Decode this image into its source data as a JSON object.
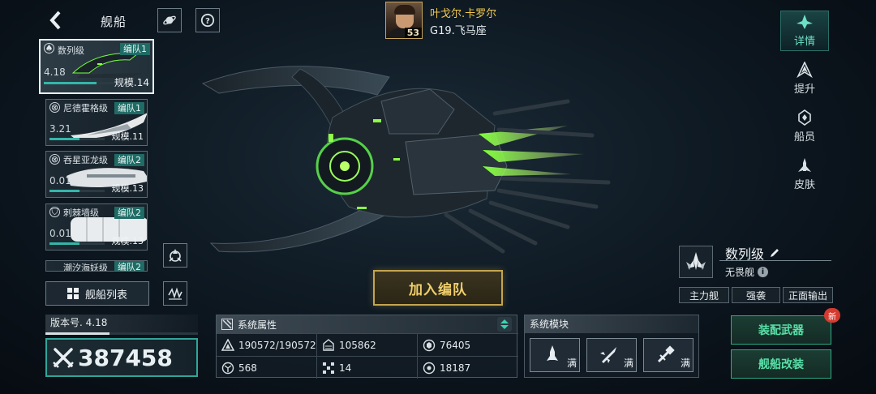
{
  "header": {
    "title": "舰船",
    "back_icon": "chevron-left-icon",
    "planet_icon": "planet-icon",
    "help_icon": "question-icon"
  },
  "captain": {
    "name": "叶戈尔.卡罗尔",
    "level": "53",
    "location": "G19.飞马座"
  },
  "ship_list": [
    {
      "name": "数列级",
      "fleet": "编队1",
      "power": "4.18",
      "scale": "规模.14",
      "hp": 0.72,
      "selected": true
    },
    {
      "name": "尼德霍格级",
      "fleet": "编队1",
      "power": "3.21",
      "scale": "规模.11",
      "hp": 0.55,
      "selected": false
    },
    {
      "name": "吞星亚龙级",
      "fleet": "编队2",
      "power": "0.01",
      "scale": "规模.13",
      "hp": 0.55,
      "selected": false
    },
    {
      "name": "刺棘墙级",
      "fleet": "编队2",
      "power": "0.01",
      "scale": "规模.13",
      "hp": 0.55,
      "selected": false
    },
    {
      "name": "潮汐海妖级",
      "fleet": "编队2"
    }
  ],
  "fleet_list_button": "舰船列表",
  "version": "版本号. 4.18",
  "version_progress": 0.42,
  "combat_power": "387458",
  "attributes": {
    "title": "系统属性",
    "items": [
      {
        "icon": "hull-icon",
        "value": "190572/190572"
      },
      {
        "icon": "armor-icon",
        "value": "105862"
      },
      {
        "icon": "shield-icon",
        "value": "76405"
      },
      {
        "icon": "speed-icon",
        "value": "568"
      },
      {
        "icon": "grid-icon",
        "value": "14"
      },
      {
        "icon": "target-icon",
        "value": "18187"
      }
    ]
  },
  "modules": {
    "title": "系统模块",
    "slots": [
      {
        "icon": "rocket-module-icon",
        "label": "满"
      },
      {
        "icon": "missile-module-icon",
        "label": "满"
      },
      {
        "icon": "drone-module-icon",
        "label": "满"
      }
    ]
  },
  "join_button": "加入编队",
  "tabs": [
    {
      "icon": "ship-detail-icon",
      "label": "详情",
      "active": true
    },
    {
      "icon": "upgrade-icon",
      "label": "提升",
      "active": false
    },
    {
      "icon": "crew-icon",
      "label": "船员",
      "active": false
    },
    {
      "icon": "skin-icon",
      "label": "皮肤",
      "active": false
    }
  ],
  "ship_info": {
    "class_name": "数列级",
    "type": "无畏舰",
    "roles": [
      "主力舰",
      "强袭",
      "正面输出"
    ]
  },
  "equip_button": "装配武器",
  "equip_badge": "新",
  "modify_button": "舰船改装",
  "colors": {
    "accent": "#2fa69a",
    "gold": "#c4a44f",
    "green_button": "#57e0a8",
    "captain_name": "#f2c94c"
  }
}
